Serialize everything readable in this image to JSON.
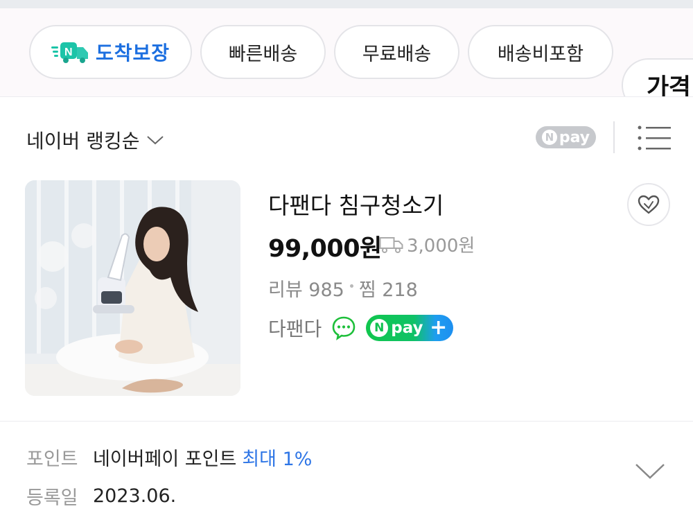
{
  "filters": {
    "arrival_label": "도착보장",
    "fast_label": "빠른배송",
    "free_label": "무료배송",
    "shipping_included_label": "배송비포함",
    "price_label": "가격"
  },
  "sort": {
    "label": "네이버 랭킹순",
    "npay_label": "pay",
    "npay_n": "N"
  },
  "product": {
    "title": "다팬다 침구청소기",
    "price": "99,000원",
    "shipping_fee": "3,000원",
    "review_label": "리뷰 985",
    "wish_label": "찜 218",
    "seller": "다팬다",
    "npay_plus_label": "pay",
    "npay_plus_n": "N",
    "npay_plus_symbol": "+"
  },
  "details": {
    "point_key": "포인트",
    "point_value": "네이버페이 포인트",
    "point_accent": "최대 1%",
    "date_key": "등록일",
    "date_value": "2023.06."
  },
  "colors": {
    "accent_blue": "#2f76e6",
    "npay_green": "#10c64d",
    "arrival_teal": "#1cc4a8"
  }
}
